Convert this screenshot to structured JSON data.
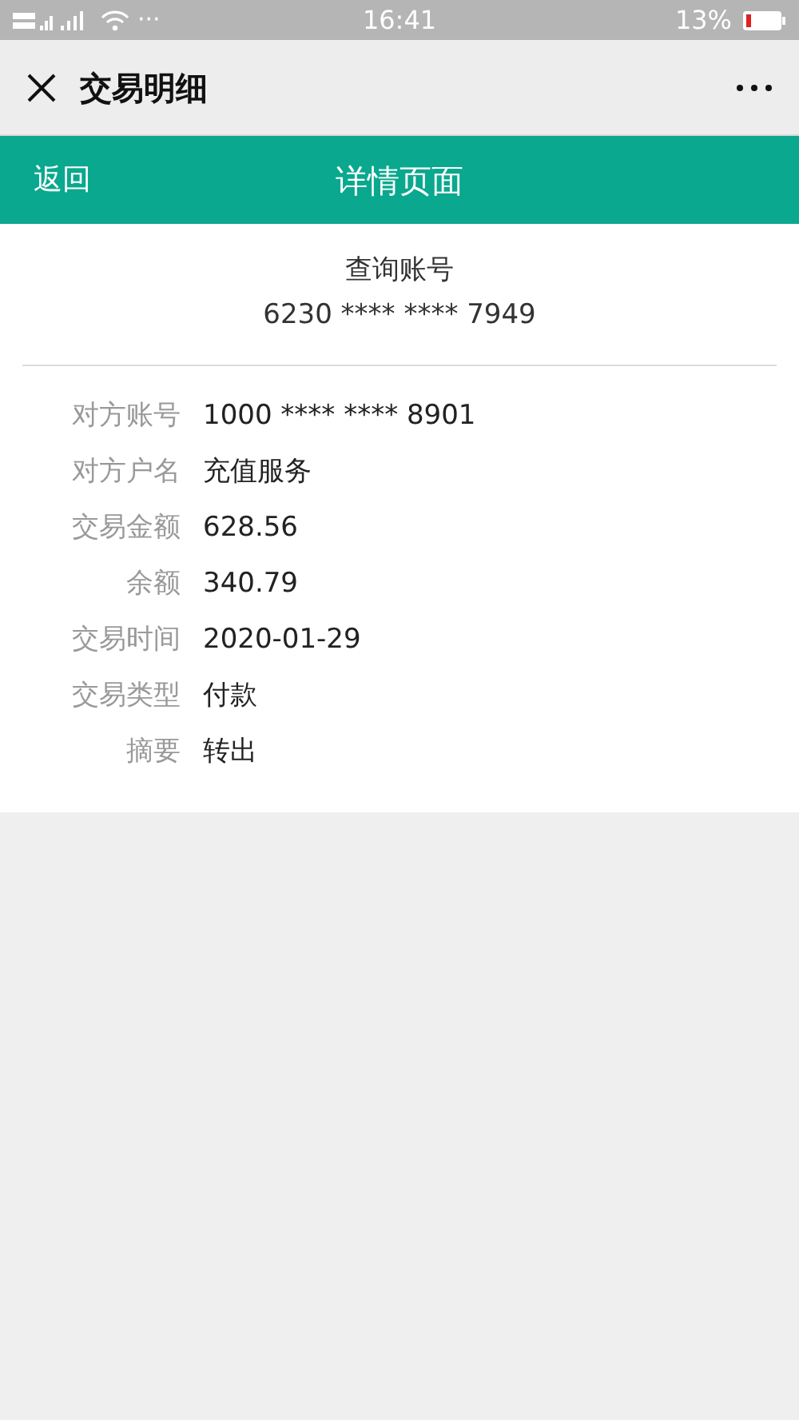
{
  "status_bar": {
    "more": "···",
    "time": "16:41",
    "battery": "13%"
  },
  "title_bar": {
    "title": "交易明细"
  },
  "header": {
    "back": "返回",
    "title": "详情页面"
  },
  "account": {
    "label": "查询账号",
    "number": "6230 **** **** 7949"
  },
  "details": [
    {
      "label": "对方账号",
      "value": "1000 **** **** 8901"
    },
    {
      "label": "对方户名",
      "value": "充值服务"
    },
    {
      "label": "交易金额",
      "value": "628.56"
    },
    {
      "label": "余额",
      "value": "340.79"
    },
    {
      "label": "交易时间",
      "value": "2020-01-29"
    },
    {
      "label": "交易类型",
      "value": "付款"
    },
    {
      "label": "摘要",
      "value": "转出"
    }
  ]
}
